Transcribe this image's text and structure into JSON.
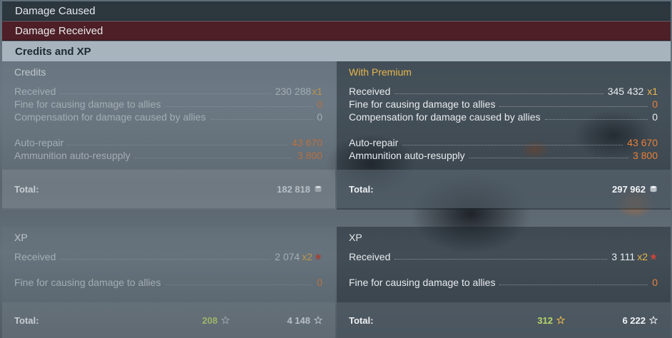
{
  "tabs": {
    "caused": "Damage Caused",
    "received": "Damage Received",
    "credits_xp": "Credits and XP"
  },
  "credits": {
    "title": "Credits",
    "received_label": "Received",
    "received_value": "230 288",
    "received_mult": "x1",
    "fine_label": "Fine for causing damage to allies",
    "fine_value": "0",
    "comp_label": "Compensation for damage caused by allies",
    "comp_value": "0",
    "repair_label": "Auto-repair",
    "repair_value": "43 670",
    "ammo_label": "Ammunition auto-resupply",
    "ammo_value": "3 800",
    "total_label": "Total:",
    "total_value": "182 818",
    "total_icon": "credits-icon"
  },
  "premium": {
    "title": "With Premium",
    "received_label": "Received",
    "received_value": "345 432",
    "received_mult": "x1",
    "fine_label": "Fine for causing damage to allies",
    "fine_value": "0",
    "comp_label": "Compensation for damage caused by allies",
    "comp_value": "0",
    "repair_label": "Auto-repair",
    "repair_value": "43 670",
    "ammo_label": "Ammunition auto-resupply",
    "ammo_value": "3 800",
    "total_label": "Total:",
    "total_value": "297 962",
    "total_icon": "credits-icon"
  },
  "xp": {
    "title": "XP",
    "received_label": "Received",
    "received_value": "2 074",
    "received_mult": "x2",
    "fine_label": "Fine for causing damage to allies",
    "fine_value": "0",
    "total_label": "Total:",
    "total_xp": "208",
    "total_free": "4 148"
  },
  "xp_premium": {
    "title": "XP",
    "received_label": "Received",
    "received_value": "3 111",
    "received_mult": "x2",
    "fine_label": "Fine for causing damage to allies",
    "fine_value": "0",
    "total_label": "Total:",
    "total_xp": "312",
    "total_free": "6 222"
  },
  "colors": {
    "premium_gold": "#e8b64c",
    "penalty_orange": "#e8803a",
    "xp_green": "#b6d76a",
    "damage_received_tab": "#4e1f26",
    "active_tab": "#a8b4bd"
  }
}
